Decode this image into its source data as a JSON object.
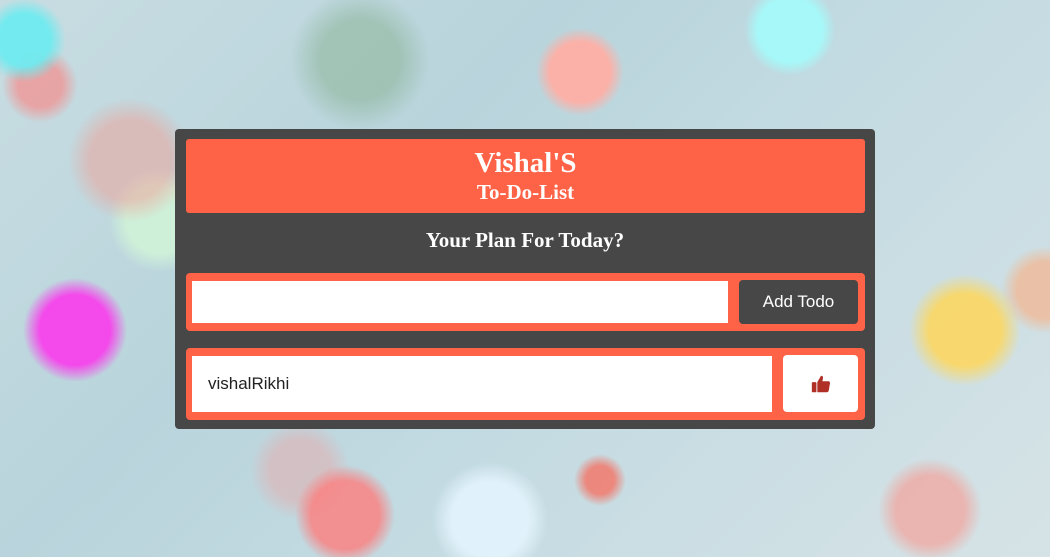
{
  "app": {
    "title": "Vishal'S",
    "subtitle": "To-Do-List",
    "prompt": "Your Plan For Today?"
  },
  "form": {
    "input_value": "",
    "input_placeholder": "",
    "add_button_label": "Add Todo"
  },
  "todos": [
    {
      "text": "vishalRikhi",
      "action_icon": "thumbs-up-icon"
    }
  ],
  "colors": {
    "accent": "#ff6347",
    "panel": "#474747",
    "icon": "#b03028"
  }
}
